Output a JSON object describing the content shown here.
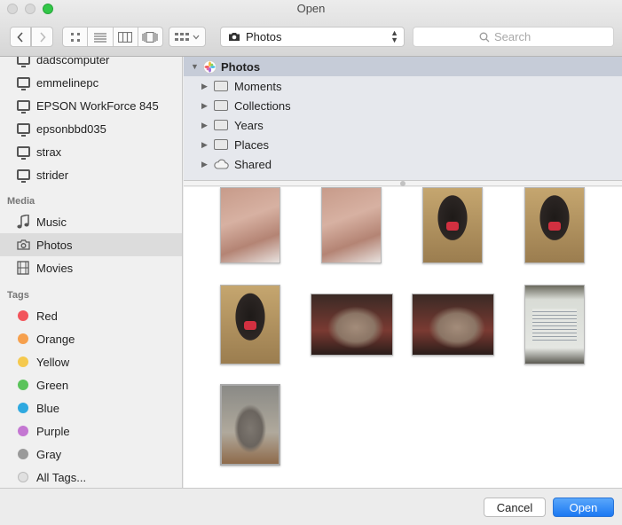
{
  "window": {
    "title": "Open"
  },
  "toolbar": {
    "location": "Photos",
    "search_placeholder": "Search"
  },
  "sidebar": {
    "devices": [
      {
        "label": "dadscomputer",
        "icon": "monitor-icon"
      },
      {
        "label": "emmelinepc",
        "icon": "monitor-icon"
      },
      {
        "label": "EPSON WorkForce 845",
        "icon": "monitor-icon"
      },
      {
        "label": "epsonbbd035",
        "icon": "monitor-icon"
      },
      {
        "label": "strax",
        "icon": "monitor-icon"
      },
      {
        "label": "strider",
        "icon": "monitor-icon"
      }
    ],
    "media_header": "Media",
    "media": [
      {
        "label": "Music",
        "icon": "music-note-icon"
      },
      {
        "label": "Photos",
        "icon": "camera-icon",
        "selected": true
      },
      {
        "label": "Movies",
        "icon": "film-icon"
      }
    ],
    "tags_header": "Tags",
    "tags": [
      {
        "label": "Red",
        "color": "#f2545b"
      },
      {
        "label": "Orange",
        "color": "#f6a04d"
      },
      {
        "label": "Yellow",
        "color": "#f5c94e"
      },
      {
        "label": "Green",
        "color": "#5ac35a"
      },
      {
        "label": "Blue",
        "color": "#2fa9e0"
      },
      {
        "label": "Purple",
        "color": "#c477d2"
      },
      {
        "label": "Gray",
        "color": "#9a9a9a"
      },
      {
        "label": "All Tags...",
        "color": "#e0e0e0"
      }
    ]
  },
  "browser": {
    "root": "Photos",
    "items": [
      "Moments",
      "Collections",
      "Years",
      "Places",
      "Shared"
    ]
  },
  "buttons": {
    "cancel": "Cancel",
    "open": "Open"
  }
}
